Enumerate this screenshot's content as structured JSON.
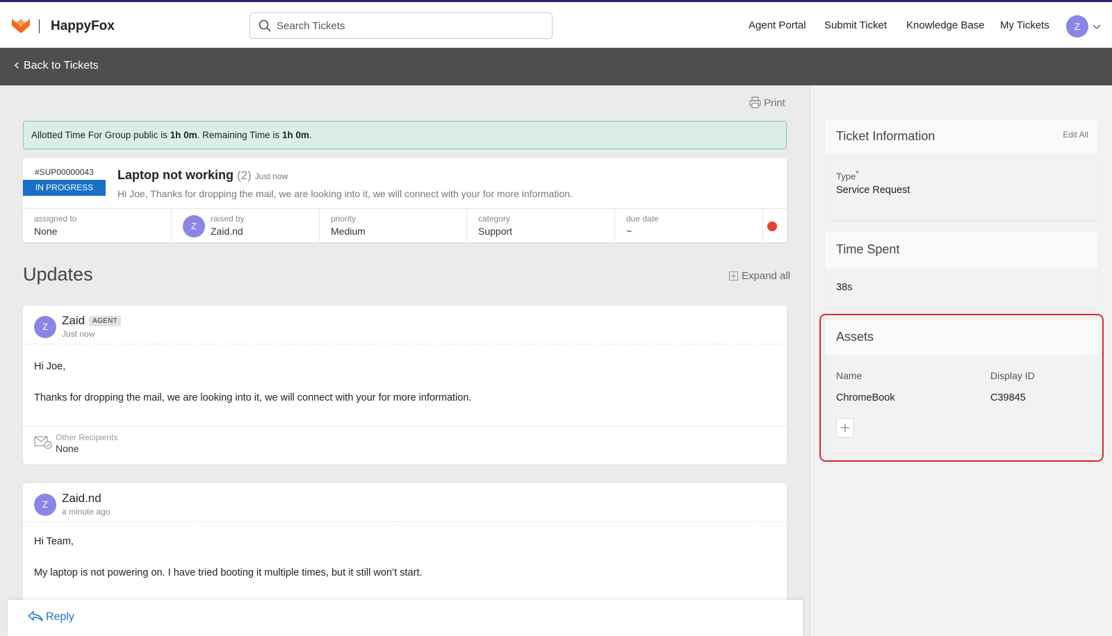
{
  "header": {
    "brand": "HappyFox",
    "search_placeholder": "Search Tickets",
    "nav": [
      "Agent Portal",
      "Submit Ticket",
      "Knowledge Base",
      "My Tickets"
    ],
    "avatar_initial": "Z"
  },
  "backbar": {
    "label": "Back to Tickets"
  },
  "print_label": "Print",
  "alert": {
    "prefix": "Allotted Time For Group public is ",
    "allotted": "1h 0m",
    "middle": ". Remaining Time is ",
    "remaining": "1h 0m",
    "suffix": "."
  },
  "ticket": {
    "id": "#SUP00000043",
    "status": "IN PROGRESS",
    "title": "Laptop not working",
    "count": "(2)",
    "time": "Just now",
    "snippet": "Hi Joe, Thanks for dropping the mail, we are looking into it, we will connect with your for more information.",
    "fields": {
      "assigned_label": "assigned to",
      "assigned_value": "None",
      "raised_label": "raised by",
      "raised_value": "Zaid.nd",
      "raised_initial": "Z",
      "priority_label": "priority",
      "priority_value": "Medium",
      "category_label": "category",
      "category_value": "Support",
      "due_label": "due date",
      "due_value": "~"
    },
    "status_color": "#e5413b"
  },
  "updates": {
    "title": "Updates",
    "expand_all": "Expand all",
    "items": [
      {
        "initial": "Z",
        "name": "Zaid",
        "badge": "AGENT",
        "time": "Just now",
        "greeting": "Hi Joe,",
        "body": "Thanks for dropping the mail, we are looking into it, we will connect with your for more information.",
        "recipients_label": "Other Recipients",
        "recipients_value": "None"
      },
      {
        "initial": "Z",
        "name": "Zaid.nd",
        "time": "a minute ago",
        "greeting": "Hi Team,",
        "body": "My laptop is not powering on. I have tried booting it multiple times, but it still won’t start."
      }
    ]
  },
  "reply_label": "Reply",
  "sidebar": {
    "ticket_info": {
      "title": "Ticket Information",
      "edit_all": "Edit All",
      "type_label": "Type",
      "required_mark": "*",
      "type_value": "Service Request"
    },
    "time_spent": {
      "title": "Time Spent",
      "value": "38s"
    },
    "assets": {
      "title": "Assets",
      "col_name": "Name",
      "col_display_id": "Display ID",
      "rows": [
        {
          "name": "ChromeBook",
          "display_id": "C39845"
        }
      ]
    }
  },
  "colors": {
    "accent": "#1a6fc7",
    "brand": "#f26b21",
    "highlight": "#e0262b",
    "status_badge": "#1a6fc7"
  }
}
